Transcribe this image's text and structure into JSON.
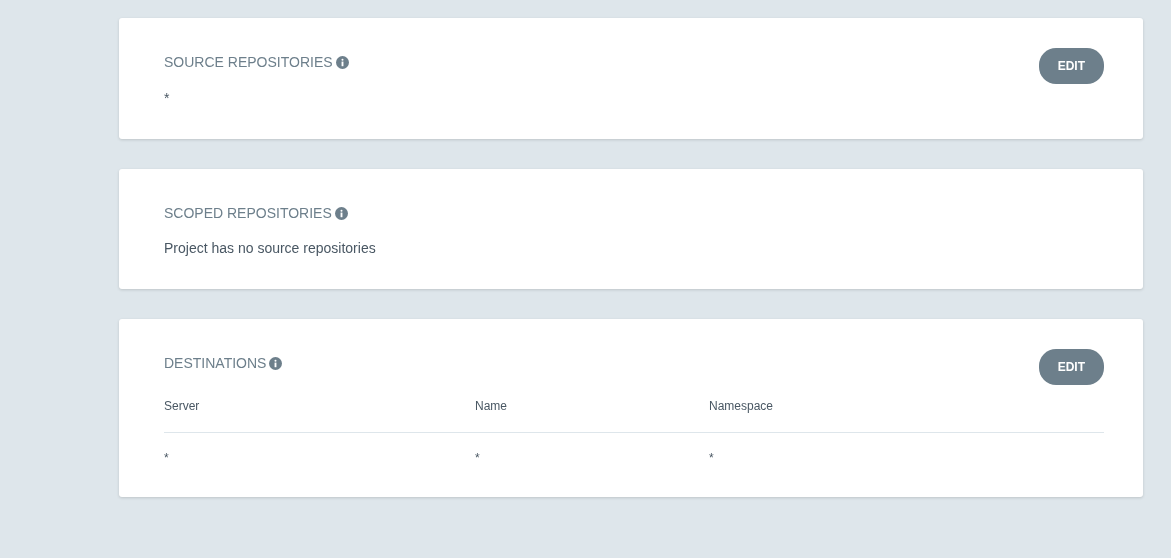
{
  "panels": [
    {
      "kind": "text",
      "title": "SOURCE REPOSITORIES",
      "info": true,
      "edit_button": "EDIT",
      "text": "*"
    },
    {
      "kind": "text",
      "title": "SCOPED REPOSITORIES",
      "info": true,
      "text": "Project has no source repositories"
    },
    {
      "kind": "table",
      "title": "DESTINATIONS",
      "info": true,
      "edit_button": "EDIT",
      "columns": [
        "Server",
        "Name",
        "Namespace"
      ],
      "rows": [
        [
          "*",
          "*",
          "*"
        ]
      ]
    }
  ]
}
